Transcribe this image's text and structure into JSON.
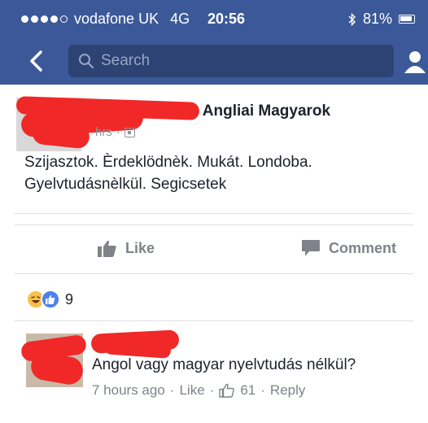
{
  "status_bar": {
    "carrier": "vodafone UK",
    "network": "4G",
    "time": "20:56",
    "battery": "81%"
  },
  "header": {
    "search_placeholder": "Search"
  },
  "post": {
    "group": "Angliai Magyarok",
    "time_label": "hrs",
    "text": "Szijasztok. Èrdeklödnèk. Mukát.   Londoba. Gyelvtudásnèlkül. Segicsetek",
    "like_label": "Like",
    "comment_label": "Comment",
    "reaction_count": "9"
  },
  "comment": {
    "text": "Angol vagy magyar nyelvtudás nélkül?",
    "time": "7 hours ago",
    "like_label": "Like",
    "like_count": "61",
    "reply_label": "Reply"
  },
  "colors": {
    "facebook_blue": "#3b5998",
    "redaction": "#f02828"
  }
}
